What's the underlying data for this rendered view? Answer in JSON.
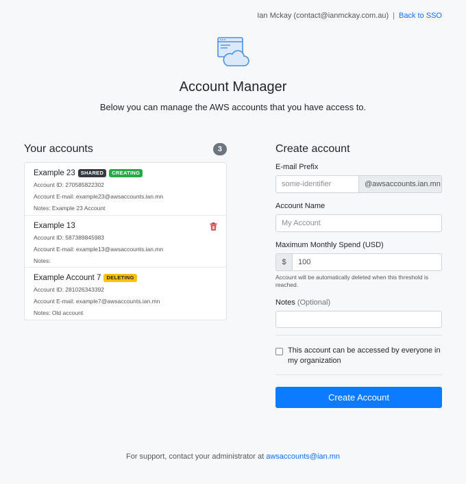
{
  "topbar": {
    "user": "Ian Mckay (contact@ianmckay.com.au)",
    "separator": "|",
    "back_link": "Back to SSO"
  },
  "logo": {
    "icon": "browser-cloud-icon",
    "accent": "#4a90e2"
  },
  "header": {
    "title": "Account Manager",
    "subtitle": "Below you can manage the AWS accounts that you have access to."
  },
  "accounts": {
    "heading": "Your accounts",
    "count": "3",
    "items": [
      {
        "name": "Example 23",
        "badges": [
          "SHARED",
          "CREATING"
        ],
        "id_line": "Account ID: 270585822302",
        "email_line": "Account E-mail: example23@awsaccounts.ian.mn",
        "notes_line": "Notes: Example 23 Account"
      },
      {
        "name": "Example 13",
        "badges": [],
        "id_line": "Account ID: 587389845983",
        "email_line": "Account E-mail: example13@awsaccounts.ian.mn",
        "notes_line": "Notes:",
        "delete_icon": "trash-icon"
      },
      {
        "name": "Example Account 7",
        "badges": [
          "DELETING"
        ],
        "id_line": "Account ID: 281026343392",
        "email_line": "Account E-mail: example7@awsaccounts.ian.mn",
        "notes_line": "Notes: Old account"
      }
    ]
  },
  "create": {
    "heading": "Create account",
    "email_label": "E-mail Prefix",
    "email_placeholder": "some-identifier",
    "email_suffix": "@awsaccounts.ian.mn",
    "name_label": "Account Name",
    "name_placeholder": "My Account",
    "spend_label": "Maximum Monthly Spend (USD)",
    "spend_prefix": "$",
    "spend_value": "100",
    "spend_help": "Account will be automatically deleted when this threshold is reached.",
    "notes_label": "Notes",
    "notes_optional": "(Optional)",
    "notes_value": "",
    "shared_checkbox_label": "This account can be accessed by everyone in my organization",
    "submit_label": "Create Account"
  },
  "footer": {
    "text": "For support, contact your administrator at",
    "email": "awsaccounts@ian.mn"
  },
  "colors": {
    "primary": "#0d7bff",
    "shared_badge": "#343a40",
    "creating_badge": "#28a745",
    "deleting_badge": "#ffc107",
    "danger": "#dc3545"
  }
}
